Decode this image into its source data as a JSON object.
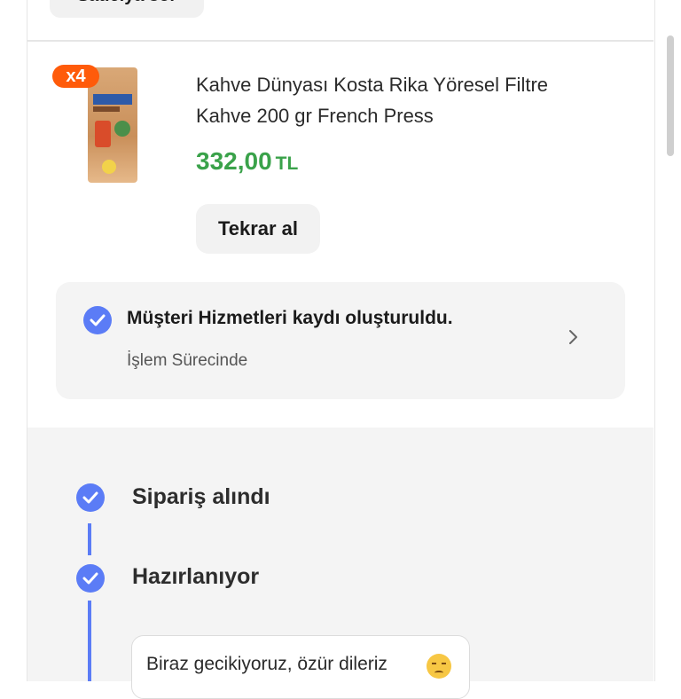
{
  "top_button": {
    "label": "Satıcıya sor"
  },
  "product": {
    "quantity_badge": "x4",
    "title": "Kahve Dünyası Kosta Rika Yöresel Filtre Kahve 200 gr French Press",
    "price_value": "332,00",
    "price_currency": "TL",
    "rebuy_label": "Tekrar al",
    "thumbnail_icon": "coffee-package-image"
  },
  "customer_service": {
    "title": "Müşteri Hizmetleri kaydı oluşturuldu.",
    "status": "İşlem Sürecinde"
  },
  "timeline": {
    "steps": [
      {
        "label": "Sipariş alındı"
      },
      {
        "label": "Hazırlanıyor"
      }
    ],
    "message": "Biraz gecikiyoruz, özür dileriz"
  },
  "colors": {
    "accent": "#5b7cf6",
    "price": "#3aa24a",
    "badge": "#ff5b0a"
  }
}
